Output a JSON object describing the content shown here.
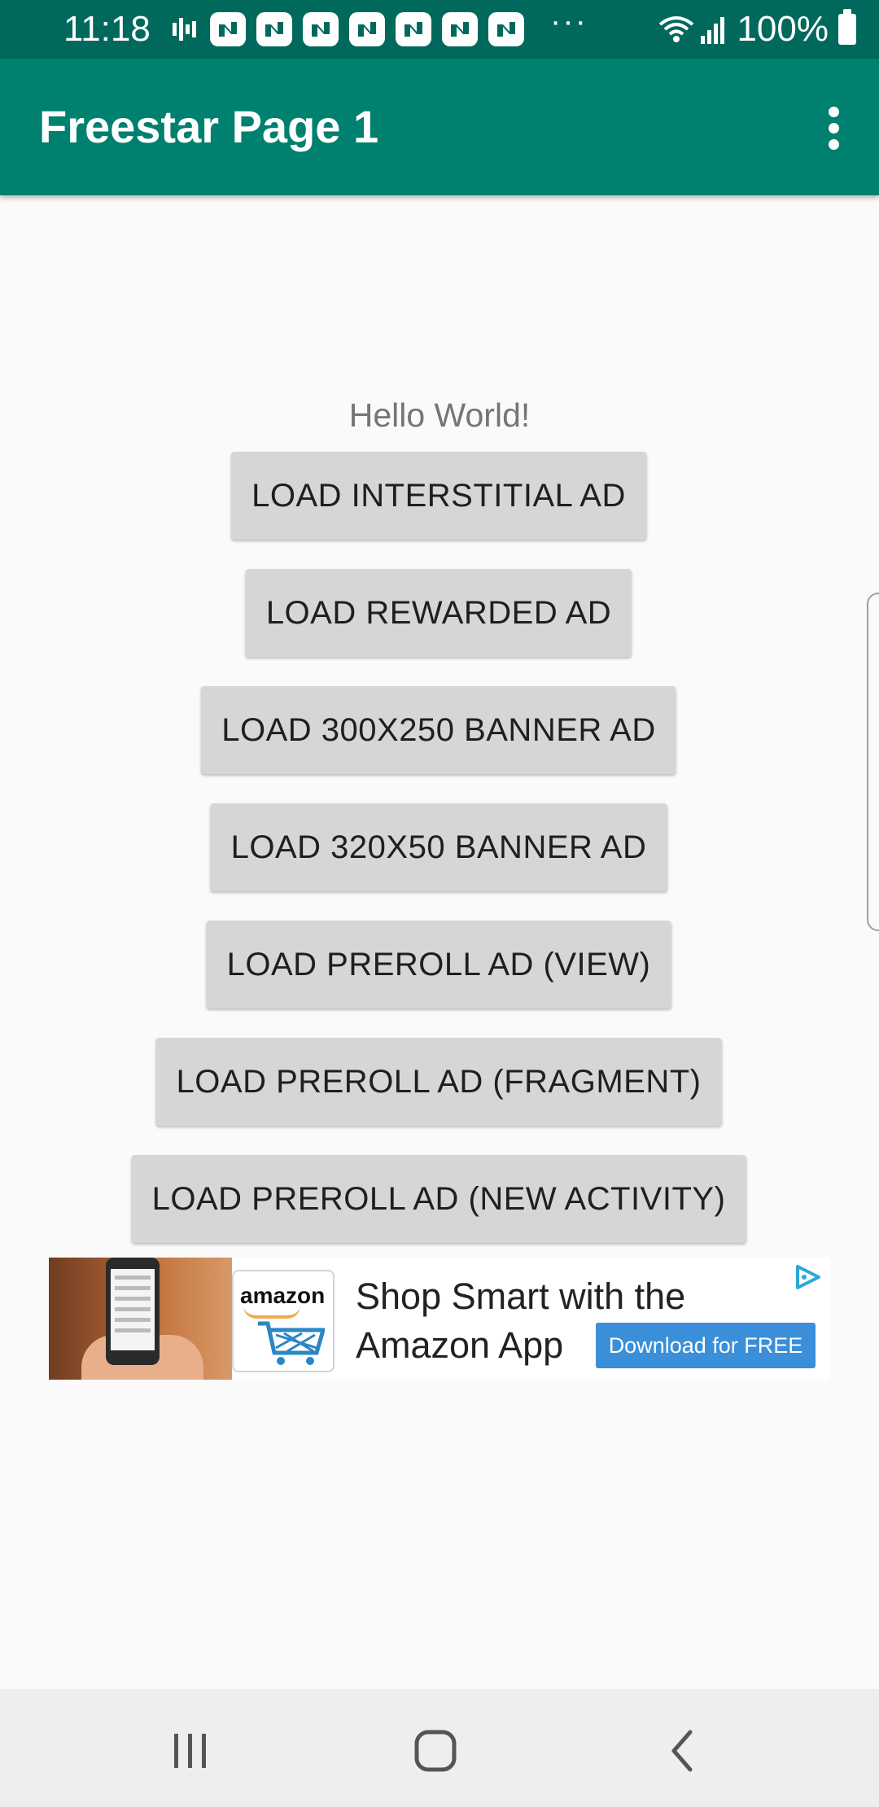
{
  "status_bar": {
    "time": "11:18",
    "more_indicator": "···",
    "battery_percent": "100%",
    "icons": [
      "activity-icon",
      "notification-icon",
      "wifi-icon",
      "signal-icon",
      "battery-icon"
    ]
  },
  "app_bar": {
    "title": "Freestar Page 1",
    "menu_icon": "overflow-menu-icon",
    "color": "#00806f"
  },
  "main": {
    "greeting": "Hello World!",
    "buttons": [
      "LOAD INTERSTITIAL AD",
      "LOAD REWARDED AD",
      "LOAD 300X250 BANNER AD",
      "LOAD 320X50 BANNER AD",
      "LOAD PREROLL AD (VIEW)",
      "LOAD PREROLL AD (FRAGMENT)",
      "LOAD PREROLL AD (NEW ACTIVITY)"
    ]
  },
  "ad": {
    "brand": "amazon",
    "headline_line1": "Shop Smart with the",
    "headline_line2": "Amazon App",
    "cta": "Download for FREE",
    "cta_color": "#3a8fd8"
  },
  "nav_bar": {
    "icons": [
      "recents-icon",
      "home-icon",
      "back-icon"
    ]
  }
}
